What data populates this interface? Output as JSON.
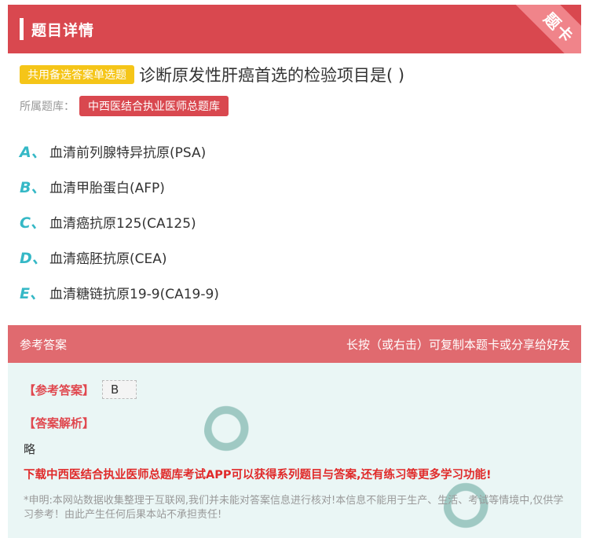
{
  "header": {
    "title": "题目详情",
    "corner_label": "题卡"
  },
  "question": {
    "type_tag": "共用备选答案单选题",
    "text": "诊断原发性肝癌首选的检验项目是( )",
    "bank_label": "所属题库：",
    "bank_name": "中西医结合执业医师总题库"
  },
  "options": [
    {
      "letter": "A、",
      "text": "血清前列腺特异抗原(PSA)"
    },
    {
      "letter": "B、",
      "text": "血清甲胎蛋白(AFP)"
    },
    {
      "letter": "C、",
      "text": "血清癌抗原125(CA125)"
    },
    {
      "letter": "D、",
      "text": "血清癌胚抗原(CEA)"
    },
    {
      "letter": "E、",
      "text": "血清糖链抗原19-9(CA19-9)"
    }
  ],
  "answer_section": {
    "title": "参考答案",
    "hint": "长按（或右击）可复制本题卡或分享给好友",
    "answer_label": "【参考答案】",
    "answer_value": "B",
    "analysis_label": "【答案解析】",
    "analysis_text": "略",
    "promo": "下载中西医结合执业医师总题库考试APP可以获得系列题目与答案,还有练习等更多学习功能!",
    "disclaimer": "*申明:本网站数据收集整理于互联网,我们并未能对答案信息进行核对!本信息不能用于生产、生活、考试等情境中,仅供学习参考！由此产生任何后果本站不承担责任!"
  },
  "colors": {
    "brand": "#d9484f",
    "tag": "#f5c518",
    "option_letter": "#35b8c6",
    "answer_bg": "#eaf6f5"
  }
}
